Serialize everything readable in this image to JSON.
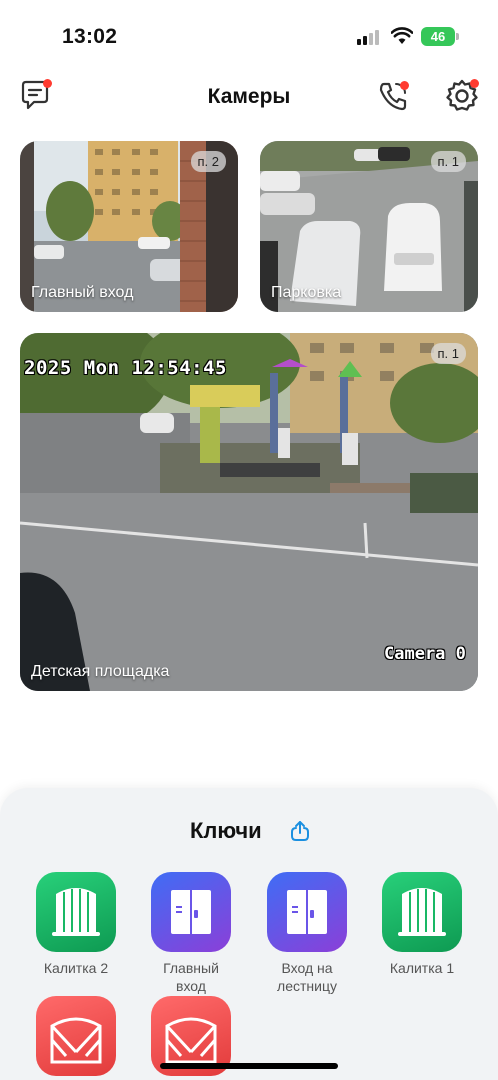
{
  "status_bar": {
    "time": "13:02",
    "battery": "46"
  },
  "header": {
    "title": "Камеры"
  },
  "cameras": [
    {
      "name": "Главный вход",
      "badge": "п. 2",
      "osd": ""
    },
    {
      "name": "Парковка",
      "badge": "п. 1",
      "osd": ""
    },
    {
      "name": "Детская площадка",
      "badge": "п. 1",
      "osd_time": "2025 Mon 12:54:45",
      "osd_cam": "Camera 0"
    }
  ],
  "keys": {
    "title": "Ключи",
    "items": [
      {
        "label": "Калитка 2",
        "color": "green",
        "icon": "gate-icon"
      },
      {
        "label": "Главный вход",
        "color": "purple",
        "icon": "door-icon"
      },
      {
        "label": "Вход на лестницу",
        "color": "purple",
        "icon": "door-icon"
      },
      {
        "label": "Калитка 1",
        "color": "green",
        "icon": "gate-icon"
      },
      {
        "label": "",
        "color": "red",
        "icon": "barrier-gate-icon"
      },
      {
        "label": "",
        "color": "red",
        "icon": "barrier-gate-icon"
      }
    ]
  },
  "colors": {
    "accent": "#1a8fe0",
    "notification": "#ff3b30",
    "gate_green": "#19b865",
    "door_purple": "#6a55e8",
    "barrier_red": "#ef4d4d"
  }
}
